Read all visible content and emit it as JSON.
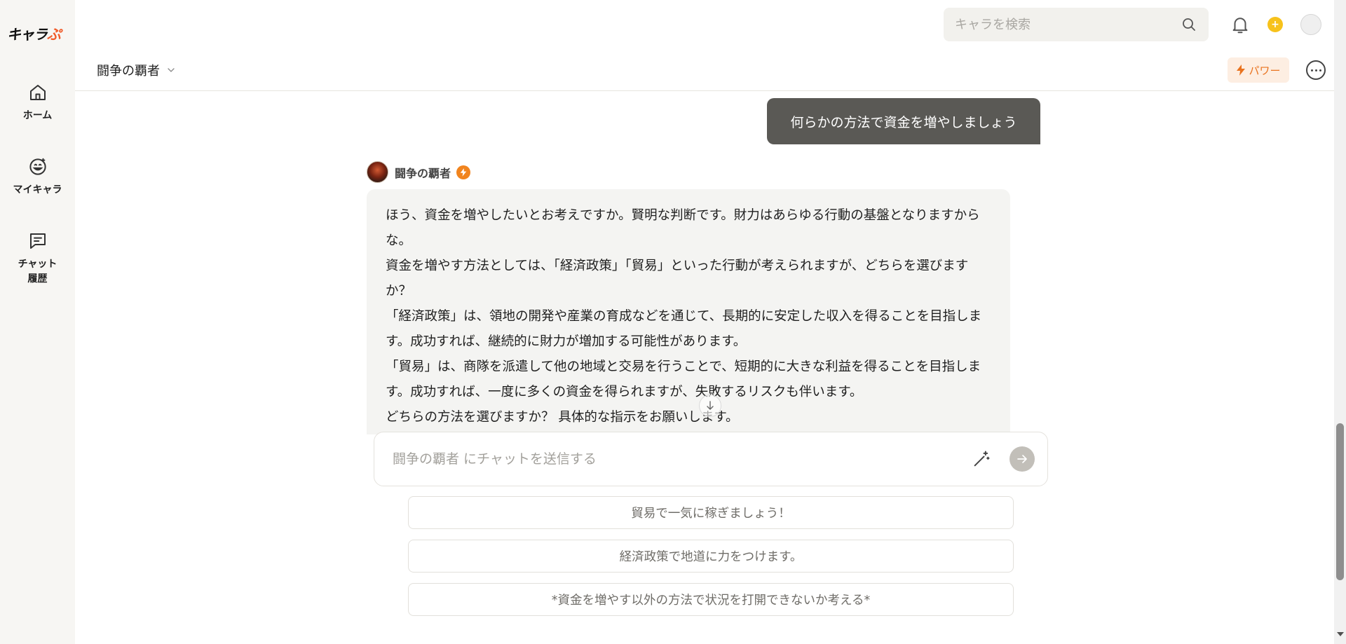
{
  "app": {
    "logo_text": "キャラ",
    "logo_accent": "ぷ"
  },
  "sidebar": {
    "items": [
      {
        "label": "ホーム",
        "icon": "home-icon"
      },
      {
        "label": "マイキャラ",
        "icon": "smile-icon"
      },
      {
        "label": "チャット\n履歴",
        "label_line1": "チャット",
        "label_line2": "履歴",
        "icon": "chat-history-icon"
      }
    ]
  },
  "topbar": {
    "search_placeholder": "キャラを検索"
  },
  "chat": {
    "title": "闘争の覇者",
    "power_label": "パワー",
    "user_message": "何らかの方法で資金を増やしましょう",
    "bot_name": "闘争の覇者",
    "bot_message": [
      "ほう、資金を増やしたいとお考えですか。賢明な判断です。財力はあらゆる行動の基盤となりますからな。",
      "資金を増やす方法としては、「経済政策」「貿易」といった行動が考えられますが、どちらを選びますか？",
      "「経済政策」は、領地の開発や産業の育成などを通じて、長期的に安定した収入を得ることを目指します。成功すれば、継続的に財力が増加する可能性があります。",
      "「貿易」は、商隊を派遣して他の地域と交易を行うことで、短期的に大きな利益を得ることを目指します。成功すれば、一度に多くの資金を得られますが、失敗するリスクも伴います。",
      "どちらの方法を選びますか？ 具体的な指示をお願いします。"
    ],
    "input_placeholder": "闘争の覇者 にチャットを送信する",
    "suggestions": [
      "貿易で一気に稼ぎましょう！",
      "経済政策で地道に力をつけます。",
      "*資金を増やす以外の方法で状況を打開できないか考える*"
    ]
  },
  "colors": {
    "accent": "#f1841e",
    "user_bubble": "#5a5955",
    "bot_bubble": "#f4f4f2",
    "sidebar_bg": "#f7f6f3"
  }
}
